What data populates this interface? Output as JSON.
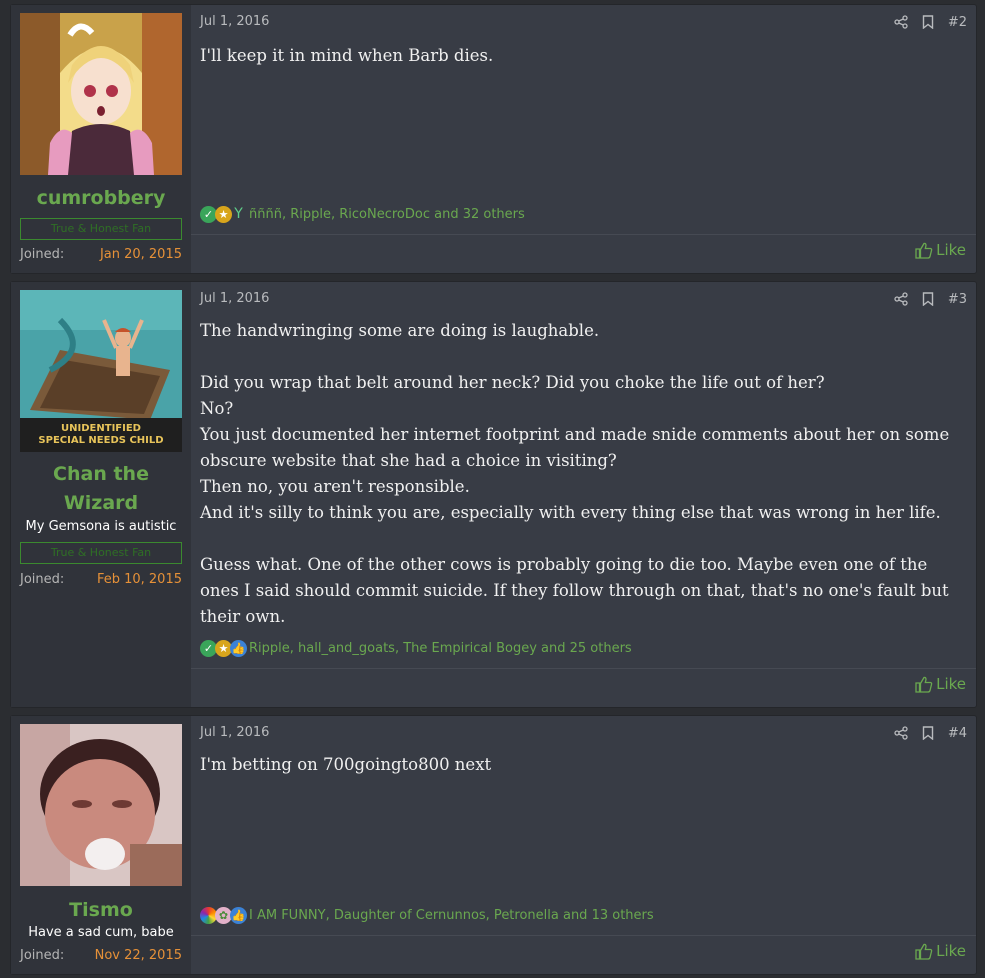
{
  "posts": [
    {
      "username": "cumrobbery",
      "user_title": "",
      "banner": "True & Honest Fan",
      "joined_label": "Joined:",
      "joined_value": "Jan 20, 2015",
      "date": "Jul 1, 2016",
      "post_number": "#2",
      "body": [
        "I'll keep it in mind when Barb dies."
      ],
      "reactions_text": "ññññ, Ripple, RicoNecroDoc and 32 others",
      "like_label": "Like"
    },
    {
      "username": "Chan the Wizard",
      "user_title": "My Gemsona is autistic",
      "banner": "True & Honest Fan",
      "joined_label": "Joined:",
      "joined_value": "Feb 10, 2015",
      "avatar_caption_1": "UNIDENTIFIED",
      "avatar_caption_2": "SPECIAL NEEDS CHILD",
      "date": "Jul 1, 2016",
      "post_number": "#3",
      "body": [
        "The handwringing some are doing is laughable.",
        "",
        "Did you wrap that belt around her neck? Did you choke the life out of her?",
        "No?",
        "You just documented her internet footprint and made snide comments about her on some obscure website that she had a choice in visiting?",
        "Then no, you aren't responsible.",
        "And it's silly to think you are, especially with every thing else that was wrong in her life.",
        "",
        "Guess what. One of the other cows is probably going to die too. Maybe even one of the ones I said should commit suicide. If they follow through on that, that's no one's fault but their own."
      ],
      "reactions_text": "Ripple, hall_and_goats, The Empirical Bogey and 25 others",
      "like_label": "Like"
    },
    {
      "username": "Tismo",
      "user_title": "Have a sad cum, babe",
      "banner": "",
      "joined_label": "Joined:",
      "joined_value": "Nov 22, 2015",
      "date": "Jul 1, 2016",
      "post_number": "#4",
      "body": [
        "I'm betting on 700goingto800 next"
      ],
      "reactions_text": "I AM FUNNY, Daughter of Cernunnos, Petronella and 13 others",
      "like_label": "Like"
    }
  ],
  "icons": [
    "share-icon",
    "bookmark-icon",
    "thumbs-up-icon",
    "check-reaction-icon",
    "medal-reaction-icon",
    "cocktail-reaction-icon",
    "like-reaction-icon",
    "rainbow-reaction-icon",
    "clover-reaction-icon"
  ],
  "colors": {
    "username": "#6aa84f",
    "joined_value": "#e69138",
    "like": "#6aa84f",
    "post_bg": "#383c45",
    "user_col_bg": "#30333a"
  }
}
